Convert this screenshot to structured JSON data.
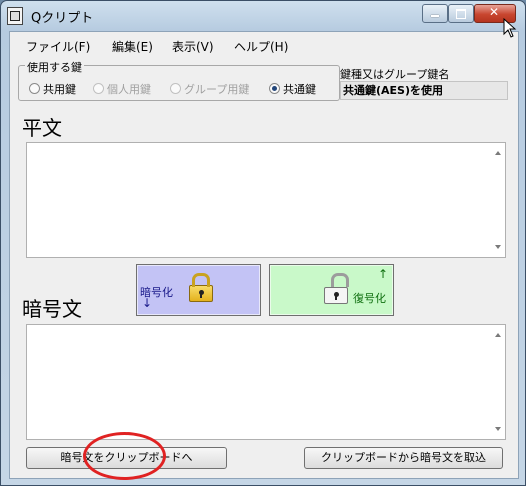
{
  "window": {
    "title": "Qクリプト"
  },
  "menu": [
    "ファイル(F)",
    "編集(E)",
    "表示(V)",
    "ヘルプ(H)"
  ],
  "key_group": {
    "legend": "使用する鍵",
    "options": [
      "共用鍵",
      "個人用鍵",
      "グループ用鍵",
      "共通鍵"
    ],
    "selected": "共通鍵"
  },
  "key_name": {
    "label": "鍵種又はグループ鍵名",
    "value": "共通鍵(AES)を使用"
  },
  "plaintext": {
    "label": "平文",
    "value": ""
  },
  "encrypt": {
    "label": "暗号化",
    "arrow": "↓"
  },
  "decrypt": {
    "label": "復号化",
    "arrow": "↑"
  },
  "ciphertext": {
    "label": "暗号文",
    "value": ""
  },
  "buttons": {
    "copy": "暗号文をクリップボードへ",
    "paste": "クリップボードから暗号文を取込"
  },
  "colors": {
    "encrypt_bg": "#c3c3f5",
    "decrypt_bg": "#c9f9c9",
    "annotation": "#e02222"
  }
}
